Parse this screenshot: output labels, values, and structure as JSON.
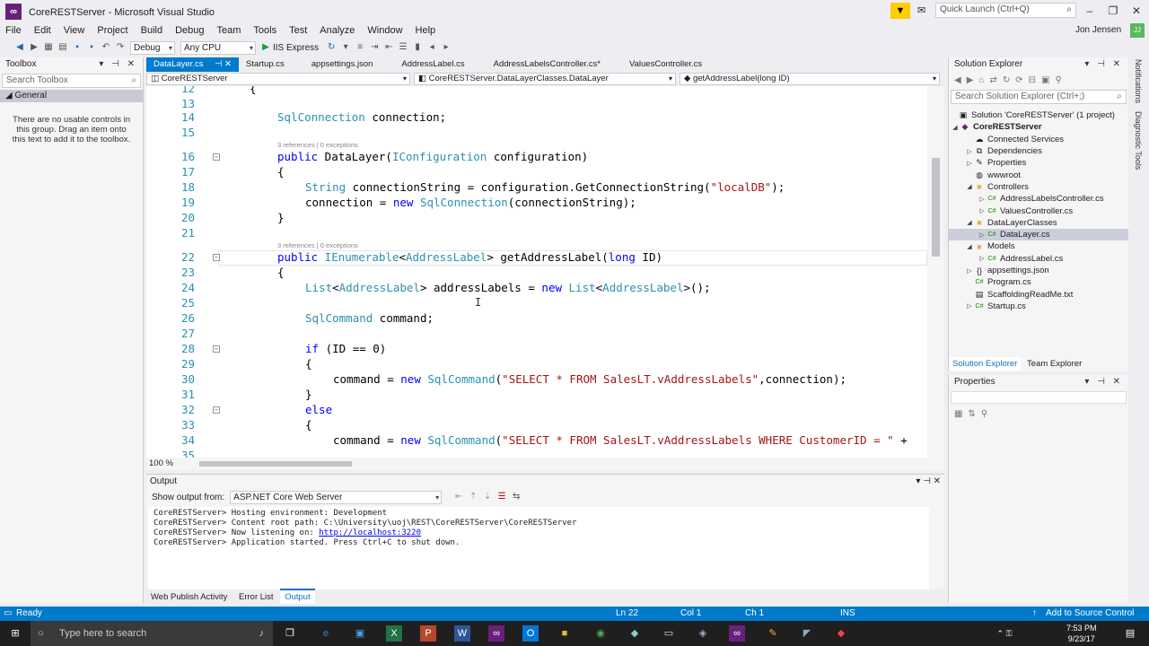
{
  "window": {
    "title": "CoreRESTServer - Microsoft Visual Studio",
    "quick_launch_placeholder": "Quick Launch (Ctrl+Q)",
    "user": "Jon Jensen",
    "avatar": "JJ"
  },
  "menu": [
    "File",
    "Edit",
    "View",
    "Project",
    "Build",
    "Debug",
    "Team",
    "Tools",
    "Test",
    "Analyze",
    "Window",
    "Help"
  ],
  "toolbar": {
    "config": "Debug",
    "platform": "Any CPU",
    "run": "IIS Express"
  },
  "toolbox": {
    "title": "Toolbox",
    "search_placeholder": "Search Toolbox",
    "group": "General",
    "empty_message": "There are no usable controls in this group. Drag an item onto this text to add it to the toolbox."
  },
  "tabs": [
    {
      "label": "DataLayer.cs"
    },
    {
      "label": "Startup.cs"
    },
    {
      "label": "appsettings.json"
    },
    {
      "label": "AddressLabel.cs"
    },
    {
      "label": "AddressLabelsController.cs*"
    },
    {
      "label": "ValuesController.cs"
    }
  ],
  "navbar": {
    "project": "CoreRESTServer",
    "class": "CoreRESTServer.DataLayerClasses.DataLayer",
    "member": "getAddressLabel(long ID)"
  },
  "code": {
    "line_numbers": [
      "12",
      "13",
      "14",
      "15",
      "16",
      "17",
      "18",
      "19",
      "20",
      "21",
      "22",
      "23",
      "24",
      "25",
      "26",
      "27",
      "28",
      "29",
      "30",
      "31",
      "32",
      "33",
      "34",
      "35"
    ],
    "codelens_1": "3 references | 0 exceptions",
    "codelens_2": "3 references | 0 exceptions",
    "l12": "{",
    "l14_type": "SqlConnection",
    "l14_rest": " connection;",
    "l16_kw": "public",
    "l16_name": " DataLayer(",
    "l16_type": "IConfiguration",
    "l16_rest": " configuration)",
    "l17": "{",
    "l18_type": "String",
    "l18_mid": " connectionString = configuration.GetConnectionString(",
    "l18_str": "\"localDB\"",
    "l18_end": ");",
    "l19_a": "connection = ",
    "l19_kw": "new",
    "l19_type": " SqlConnection",
    "l19_rest": "(connectionString);",
    "l20": "}",
    "l22_kw": "public",
    "l22_t1": " IEnumerable",
    "l22_lt": "<",
    "l22_t2": "AddressLabel",
    "l22_rest": "> getAddressLabel(",
    "l22_kw2": "long",
    "l22_end": " ID)",
    "l23": "{",
    "l24_t1": "List",
    "l24_lt": "<",
    "l24_t2": "AddressLabel",
    "l24_mid": "> addressLabels = ",
    "l24_kw": "new",
    "l24_t3": " List",
    "l24_lt2": "<",
    "l24_t4": "AddressLabel",
    "l24_end": ">();",
    "l26_type": "SqlCommand",
    "l26_rest": " command;",
    "l28_kw": "if",
    "l28_rest": " (ID == 0)",
    "l29": "{",
    "l30_a": "command = ",
    "l30_kw": "new",
    "l30_type": " SqlCommand",
    "l30_p": "(",
    "l30_str": "\"SELECT * FROM SalesLT.vAddressLabels\"",
    "l30_end": ",connection);",
    "l31": "}",
    "l32_kw": "else",
    "l33": "{",
    "l34_a": "command = ",
    "l34_kw": "new",
    "l34_type": " SqlCommand",
    "l34_p": "(",
    "l34_str": "\"SELECT * FROM SalesLT.vAddressLabels WHERE CustomerID = \"",
    "l34_end": " +"
  },
  "zoom": "100 %",
  "output": {
    "title": "Output",
    "show_from_label": "Show output from:",
    "source": "ASP.NET Core Web Server",
    "lines": [
      "CoreRESTServer> Hosting environment: Development",
      "CoreRESTServer> Content root path: C:\\University\\uoj\\REST\\CoreRESTServer\\CoreRESTServer",
      "CoreRESTServer> Now listening on: ",
      "CoreRESTServer> Application started. Press Ctrl+C to shut down."
    ],
    "link": "http://localhost:3220"
  },
  "bottom_tabs": [
    "Web Publish Activity",
    "Error List",
    "Output"
  ],
  "solution_explorer": {
    "title": "Solution Explorer",
    "search_placeholder": "Search Solution Explorer (Ctrl+;)",
    "items": [
      {
        "label": "Solution 'CoreRESTServer' (1 project)"
      },
      {
        "label": "CoreRESTServer"
      },
      {
        "label": "Connected Services"
      },
      {
        "label": "Dependencies"
      },
      {
        "label": "Properties"
      },
      {
        "label": "wwwroot"
      },
      {
        "label": "Controllers"
      },
      {
        "label": "AddressLabelsController.cs"
      },
      {
        "label": "ValuesController.cs"
      },
      {
        "label": "DataLayerClasses"
      },
      {
        "label": "DataLayer.cs"
      },
      {
        "label": "Models"
      },
      {
        "label": "AddressLabel.cs"
      },
      {
        "label": "appsettings.json"
      },
      {
        "label": "Program.cs"
      },
      {
        "label": "ScaffoldingReadMe.txt"
      },
      {
        "label": "Startup.cs"
      }
    ],
    "tabs": [
      "Solution Explorer",
      "Team Explorer"
    ]
  },
  "properties": {
    "title": "Properties"
  },
  "side_strip": [
    "Notifications",
    "Diagnostic Tools"
  ],
  "status": {
    "state": "Ready",
    "ln": "Ln 22",
    "col": "Col 1",
    "ch": "Ch 1",
    "ins": "INS",
    "source_control": "Add to Source Control"
  },
  "taskbar": {
    "search_placeholder": "Type here to search",
    "time": "7:53 PM",
    "date": "9/23/17"
  }
}
